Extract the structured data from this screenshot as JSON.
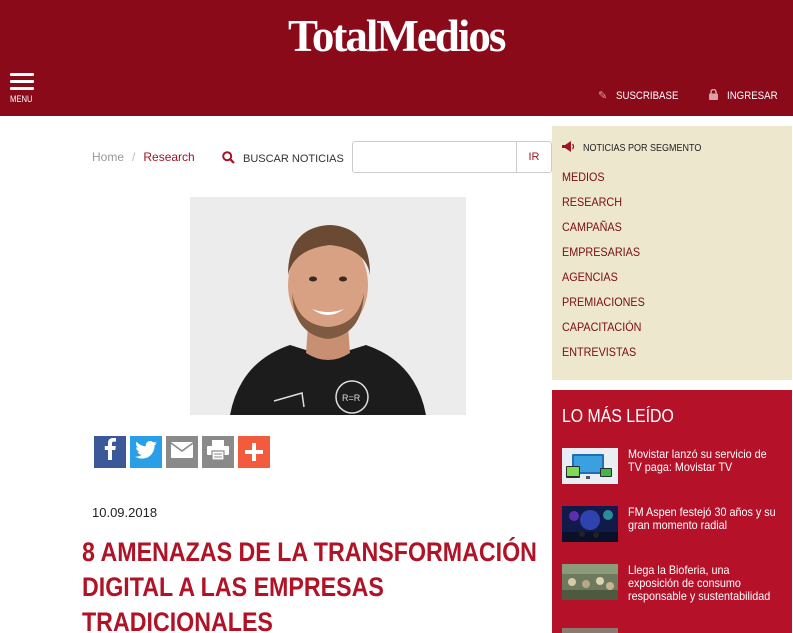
{
  "header": {
    "logo": "TotalMedios",
    "menu_label": "MENU",
    "subscribe_label": "SUSCRIBASE",
    "login_label": "INGRESAR",
    "background": "#8b0a1a"
  },
  "breadcrumb": {
    "home": "Home",
    "separator": "/",
    "current": "Research"
  },
  "search": {
    "label": "BUSCAR NOTICIAS",
    "value": "",
    "placeholder": "",
    "button": "IR"
  },
  "article": {
    "date": "10.09.2018",
    "title": "8 AMENAZAS DE LA TRANSFORMACIÓN DIGITAL A LAS EMPRESAS TRADICIONALES",
    "title_color": "#b01226",
    "share_icons": [
      "facebook-icon",
      "twitter-icon",
      "email-icon",
      "print-icon",
      "plus-icon"
    ]
  },
  "segments": {
    "title": "NOTICIAS POR SEGMENTO",
    "background": "#ede7cd",
    "items": [
      "MEDIOS",
      "RESEARCH",
      "CAMPAÑAS",
      "EMPRESARIAS",
      "AGENCIAS",
      "PREMIACIONES",
      "CAPACITACIÓN",
      "ENTREVISTAS"
    ]
  },
  "most_read": {
    "title": "LO MÁS LEÍDO",
    "background": "#b5122a",
    "items": [
      {
        "text": "Movistar lanzó su servicio de TV paga: Movistar TV"
      },
      {
        "text": "FM Aspen festejó 30 años y su gran momento radial"
      },
      {
        "text": "Llega la Bioferia, una exposición de consumo responsable y sustentabilidad"
      }
    ]
  }
}
